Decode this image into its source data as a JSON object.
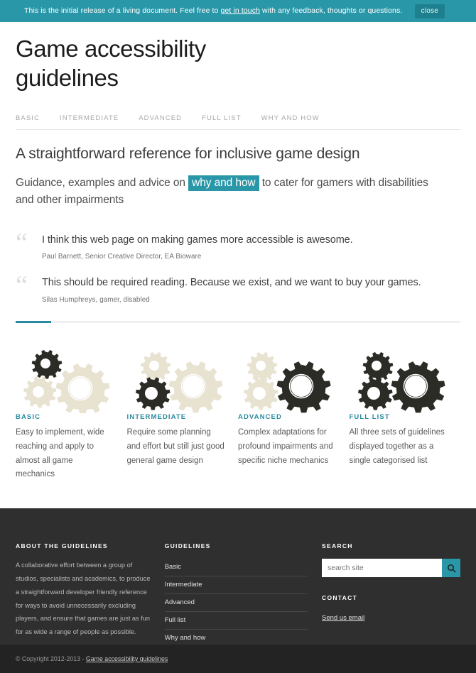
{
  "banner": {
    "text_before": "This is the initial release of a living document. Feel free to ",
    "link": "get in touch",
    "text_after": " with any feedback, thoughts or questions.",
    "close_label": "close",
    "bg_color": "#2a97a8",
    "close_bg_color": "#1e7f8e"
  },
  "header": {
    "title": "Game accessibility guidelines"
  },
  "nav": {
    "items": [
      {
        "label": "BASIC"
      },
      {
        "label": "INTERMEDIATE"
      },
      {
        "label": "ADVANCED"
      },
      {
        "label": "FULL LIST"
      },
      {
        "label": "WHY AND HOW"
      }
    ]
  },
  "intro": {
    "tagline": "A straightforward reference for inclusive game design",
    "lede_before": "Guidance, examples and advice on ",
    "lede_highlight": "why and how",
    "lede_after": " to cater for gamers with disabilities and other impairments",
    "highlight_color": "#2a97a8"
  },
  "quotes": [
    {
      "mark": "“",
      "text": "I think this web page on making games more accessible is awesome.",
      "cite": "Paul Barnett, Senior Creative Director, EA Bioware"
    },
    {
      "mark": "“",
      "text": "This should be required reading. Because we exist, and we want to buy your games.",
      "cite": "Silas Humphreys, gamer, disabled"
    }
  ],
  "divider": {
    "accent_color": "#2a8ba0",
    "track_color": "#efefef"
  },
  "cards": [
    {
      "title": "BASIC",
      "desc": "Easy to implement, wide reaching and apply to almost all game mechanics",
      "gears": {
        "top_small": "dark",
        "bottom_small": "light",
        "large": "light"
      }
    },
    {
      "title": "INTERMEDIATE",
      "desc": "Require some planning and effort but still just good general game design",
      "gears": {
        "top_small": "light",
        "bottom_small": "dark",
        "large": "light"
      }
    },
    {
      "title": "ADVANCED",
      "desc": "Complex adaptations for profound impairments and specific niche mechanics",
      "gears": {
        "top_small": "light",
        "bottom_small": "light",
        "large": "dark"
      }
    },
    {
      "title": "FULL LIST",
      "desc": "All three sets of guidelines displayed together as a single categorised list",
      "gears": {
        "top_small": "dark",
        "bottom_small": "dark",
        "large": "dark"
      }
    }
  ],
  "palette": {
    "gear_dark": "#2c2c26",
    "gear_light": "#e8e2d1",
    "card_title": "#2a8ba0",
    "footer_bg": "#2f2f2f",
    "copybar_bg": "#232323"
  },
  "footer": {
    "about": {
      "heading": "ABOUT THE GUIDELINES",
      "body": "A collaborative effort between a group of studios, specialists and academics, to produce a straightforward developer friendly reference for ways to avoid unnecessarily excluding players, and ensure that games are just as fun for as wide a range of people as possible."
    },
    "guidelines": {
      "heading": "GUIDELINES",
      "items": [
        {
          "label": "Basic"
        },
        {
          "label": "Intermediate"
        },
        {
          "label": "Advanced"
        },
        {
          "label": "Full list"
        },
        {
          "label": "Why and how"
        }
      ]
    },
    "search": {
      "heading": "SEARCH",
      "placeholder": "search site",
      "value": "",
      "button_icon": "search-icon"
    },
    "contact": {
      "heading": "CONTACT",
      "link_label": "Send us email"
    }
  },
  "copyright": {
    "prefix": "© Copyright 2012-2013 - ",
    "link": "Game accessibility guidelines"
  }
}
